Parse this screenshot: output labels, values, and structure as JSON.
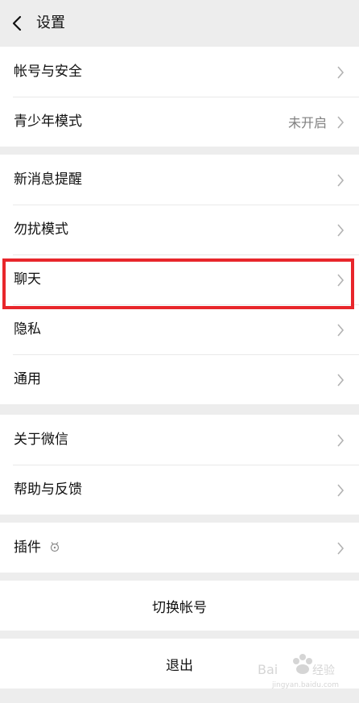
{
  "header": {
    "title": "设置",
    "back_icon": "chevron-left-icon"
  },
  "groups": [
    {
      "items": [
        {
          "label": "帐号与安全"
        },
        {
          "label": "青少年模式",
          "value": "未开启"
        }
      ]
    },
    {
      "items": [
        {
          "label": "新消息提醒"
        },
        {
          "label": "勿扰模式"
        },
        {
          "label": "聊天"
        },
        {
          "label": "隐私"
        },
        {
          "label": "通用"
        }
      ]
    },
    {
      "items": [
        {
          "label": "关于微信"
        },
        {
          "label": "帮助与反馈"
        }
      ]
    },
    {
      "items": [
        {
          "label": "插件",
          "icon": "plugin-icon"
        }
      ]
    }
  ],
  "actions": {
    "switch_account": "切换帐号",
    "logout": "退出"
  },
  "highlight": {
    "target": "聊天",
    "color": "#e8262b"
  }
}
